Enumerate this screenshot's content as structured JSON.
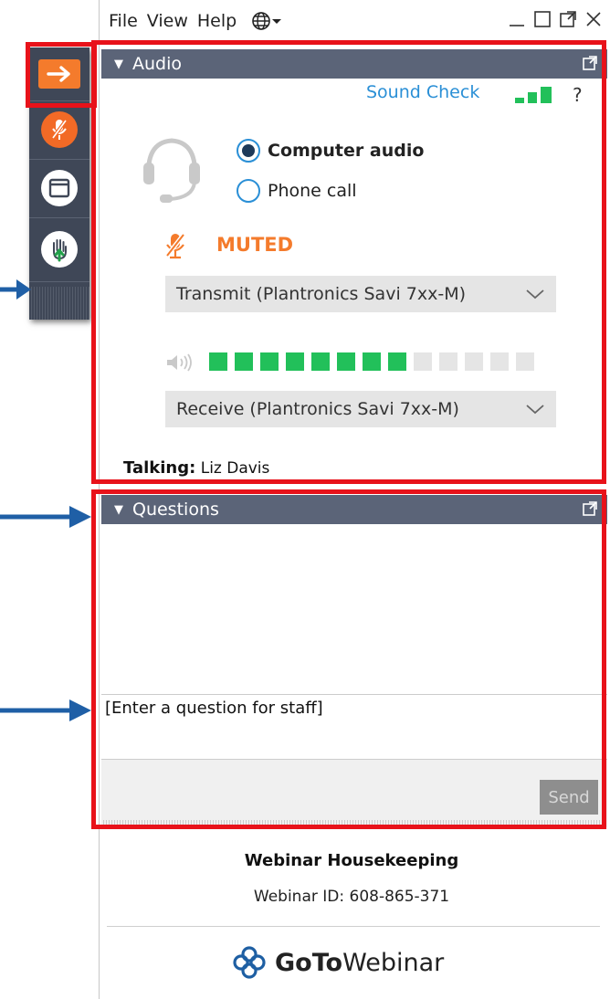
{
  "menu": {
    "file": "File",
    "view": "View",
    "help": "Help"
  },
  "audio": {
    "title": "Audio",
    "sound_check": "Sound Check",
    "help": "?",
    "computer_audio": "Computer audio",
    "phone_call": "Phone call",
    "selected_mode": "Computer audio",
    "muted": "MUTED",
    "transmit": "Transmit (Plantronics Savi 7xx-M)",
    "receive": "Receive (Plantronics Savi 7xx-M)",
    "speaker_level_segments_on": 8,
    "speaker_level_segments_total": 13,
    "talking_label": "Talking:",
    "talking_name": "Liz Davis"
  },
  "questions": {
    "title": "Questions",
    "input_text": "[Enter a question for staff]",
    "send": "Send"
  },
  "footer": {
    "title": "Webinar Housekeeping",
    "webinar_id": "Webinar ID: 608-865-371",
    "logo_goto": "GoTo",
    "logo_webinar": "Webinar"
  },
  "colors": {
    "header": "#5b6478",
    "accent_orange": "#f47b2c",
    "link_blue": "#2a8fd6",
    "level_green": "#22c05a",
    "highlight_red": "#e8121a",
    "arrow_blue": "#1f5fa6"
  }
}
